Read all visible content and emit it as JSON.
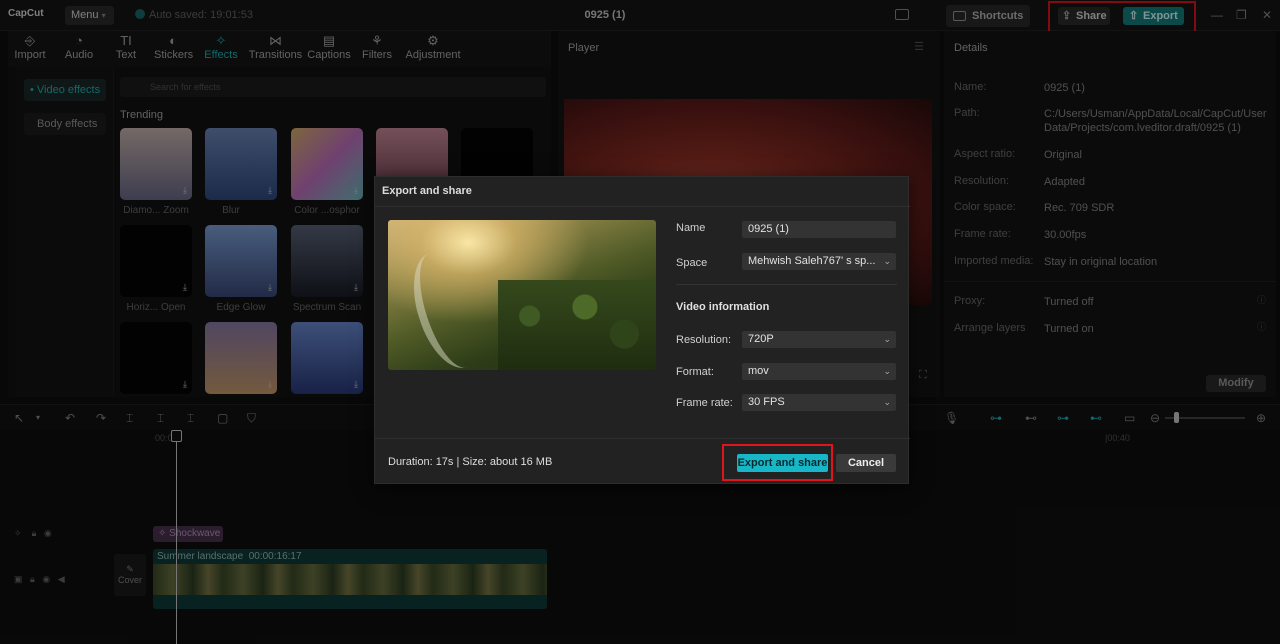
{
  "app": {
    "logo": "CapCut",
    "menu_label": "Menu",
    "autosave": "Auto saved: 19:01:53",
    "project_title": "0925 (1)",
    "shortcuts_label": "Shortcuts",
    "share_label": "Share",
    "export_label": "Export",
    "accent_color": "#1fb5b5",
    "highlight_color": "#e0141e"
  },
  "toolbar": {
    "items": [
      {
        "label": "Import",
        "icon": "import-icon"
      },
      {
        "label": "Audio",
        "icon": "audio-icon"
      },
      {
        "label": "Text",
        "icon": "text-icon"
      },
      {
        "label": "Stickers",
        "icon": "stickers-icon"
      },
      {
        "label": "Effects",
        "icon": "effects-icon",
        "active": true
      },
      {
        "label": "Transitions",
        "icon": "transitions-icon"
      },
      {
        "label": "Captions",
        "icon": "captions-icon"
      },
      {
        "label": "Filters",
        "icon": "filters-icon"
      },
      {
        "label": "Adjustment",
        "icon": "adjustment-icon"
      }
    ]
  },
  "effects_panel": {
    "nav": [
      "• Video effects",
      "Body effects"
    ],
    "search_placeholder": "Search for effects",
    "section_title": "Trending",
    "tiles": [
      {
        "label": "Diamo... Zoom"
      },
      {
        "label": "Blur"
      },
      {
        "label": "Color ...osphor"
      },
      {
        "label": ""
      },
      {
        "label": ""
      },
      {
        "label": "Horiz... Open"
      },
      {
        "label": "Edge Glow"
      },
      {
        "label": "Spectrum Scan"
      },
      {
        "label": ""
      },
      {
        "label": ""
      },
      {
        "label": ""
      }
    ]
  },
  "player": {
    "header": "Player"
  },
  "details": {
    "header": "Details",
    "rows": [
      {
        "label": "Name:",
        "value": "0925 (1)"
      },
      {
        "label": "Path:",
        "value": "C:/Users/Usman/AppData/Local/CapCut/User Data/Projects/com.lveditor.draft/0925 (1)"
      },
      {
        "label": "Aspect ratio:",
        "value": "Original"
      },
      {
        "label": "Resolution:",
        "value": "Adapted"
      },
      {
        "label": "Color space:",
        "value": "Rec. 709 SDR"
      },
      {
        "label": "Frame rate:",
        "value": "30.00fps"
      },
      {
        "label": "Imported media:",
        "value": "Stay in original location"
      },
      {
        "label": "Proxy:",
        "value": "Turned off"
      },
      {
        "label": "Arrange layers",
        "value": "Turned on"
      }
    ],
    "modify_label": "Modify"
  },
  "timeline": {
    "ruler_start": "00:00",
    "ruler_mark": "|00:40",
    "effect_clip": "Shockwave",
    "video_clip_name": "Summer landscape",
    "video_clip_duration": "00:00:16:17",
    "cover_label": "Cover"
  },
  "dialog": {
    "title": "Export and share",
    "name_label": "Name",
    "name_value": "0925 (1)",
    "space_label": "Space",
    "space_value": "Mehwish Saleh767'  s sp...",
    "video_info_title": "Video information",
    "resolution_label": "Resolution:",
    "resolution_value": "720P",
    "format_label": "Format:",
    "format_value": "mov",
    "frame_rate_label": "Frame rate:",
    "frame_rate_value": "30 FPS",
    "footer_info": "Duration: 17s | Size: about 16 MB",
    "export_share_label": "Export and share",
    "cancel_label": "Cancel"
  }
}
